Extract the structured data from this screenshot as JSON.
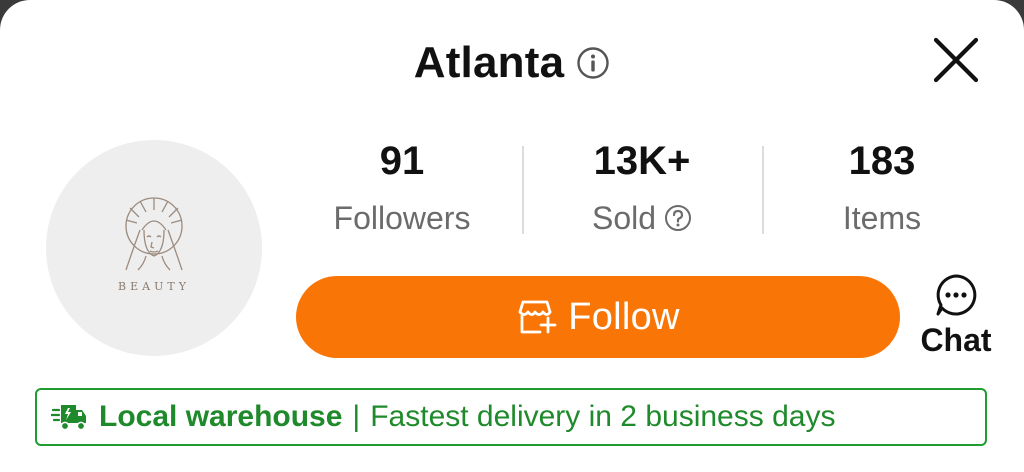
{
  "header": {
    "store_name": "Atlanta",
    "info_icon": "info-circle-icon",
    "close_icon": "close-x-icon"
  },
  "avatar": {
    "logo_icon": "woman-face-logo-icon",
    "logo_text": "BEAUTY"
  },
  "stats": [
    {
      "value": "91",
      "label": "Followers"
    },
    {
      "value": "13K+",
      "label": "Sold",
      "help_icon": "question-circle-icon"
    },
    {
      "value": "183",
      "label": "Items"
    }
  ],
  "actions": {
    "follow_label": "Follow",
    "follow_icon": "store-plus-icon",
    "chat_label": "Chat",
    "chat_icon": "chat-bubble-icon"
  },
  "banner": {
    "icon": "fast-truck-icon",
    "strong_text": "Local warehouse",
    "separator": "|",
    "text": "Fastest delivery in 2 business days"
  },
  "colors": {
    "accent": "#f97606",
    "green": "#1f8a2b",
    "muted": "#6b6b6b",
    "background": "#ffffff"
  }
}
